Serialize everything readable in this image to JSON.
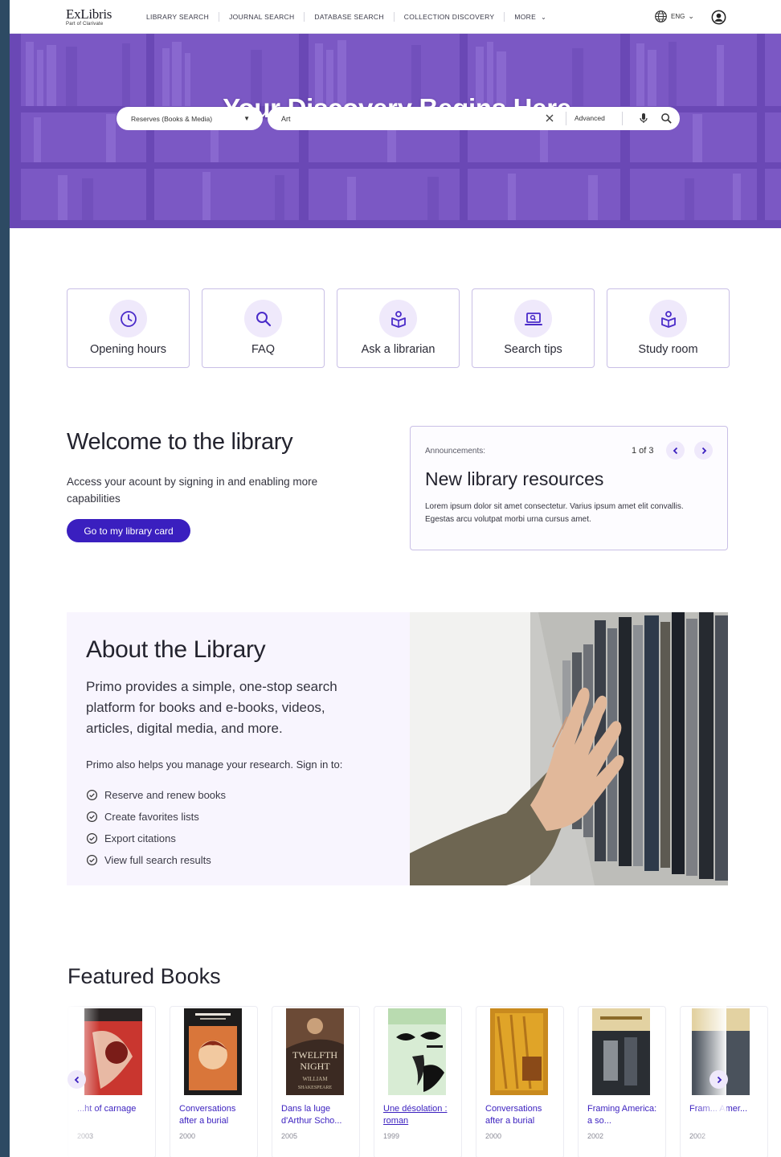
{
  "header": {
    "logo_main": "ExLibris",
    "logo_sub": "Part of Clarivate",
    "nav": [
      {
        "label": "LIBRARY SEARCH"
      },
      {
        "label": "JOURNAL SEARCH"
      },
      {
        "label": "DATABASE SEARCH"
      },
      {
        "label": "COLLECTION DISCOVERY"
      },
      {
        "label": "MORE"
      }
    ],
    "language": "ENG"
  },
  "hero": {
    "title": "Your Discovery Begins Here",
    "scope_value": "Reserves (Books & Media)",
    "search_value": "Art",
    "advanced_label": "Advanced"
  },
  "tiles": [
    {
      "label": "Opening hours",
      "icon": "clock-icon"
    },
    {
      "label": "FAQ",
      "icon": "search-icon"
    },
    {
      "label": "Ask a librarian",
      "icon": "librarian-icon"
    },
    {
      "label": "Search tips",
      "icon": "laptop-search-icon"
    },
    {
      "label": "Study room",
      "icon": "study-room-icon"
    }
  ],
  "welcome": {
    "title": "Welcome to the library",
    "text": "Access your acount by signing in and enabling more capabilities",
    "button": "Go to my library card"
  },
  "announcement": {
    "kicker": "Announcements:",
    "count": "1 of 3",
    "title": "New library resources",
    "body": "Lorem ipsum dolor sit amet consectetur. Varius ipsum amet elit convallis. Egestas arcu volutpat morbi urna cursus amet."
  },
  "about": {
    "title": "About the Library",
    "lead": "Primo provides a simple, one-stop search platform for books and e-books, videos, articles, digital media, and more.",
    "sub": "Primo also helps you manage your research. Sign in to:",
    "items": [
      "Reserve and renew books",
      "Create favorites lists",
      "Export citations",
      "View full search results"
    ]
  },
  "featured": {
    "title": "Featured Books",
    "books": [
      {
        "title": "...ht of carnage",
        "year": "2003"
      },
      {
        "title": "Conversations after a burial",
        "year": "2000"
      },
      {
        "title": "Dans la luge d'Arthur Scho...",
        "year": "2005"
      },
      {
        "title": "Une désolation : roman",
        "year": "1999"
      },
      {
        "title": "Conversations after a burial",
        "year": "2000"
      },
      {
        "title": "Framing America: a so...",
        "year": "2002"
      },
      {
        "title": "Fram... Amer...",
        "year": "2002"
      }
    ]
  },
  "colors": {
    "accent": "#3a1fbf",
    "hero": "#7c5bc6",
    "tile_border": "#c9bfe6",
    "soft": "#f8f5fe"
  }
}
